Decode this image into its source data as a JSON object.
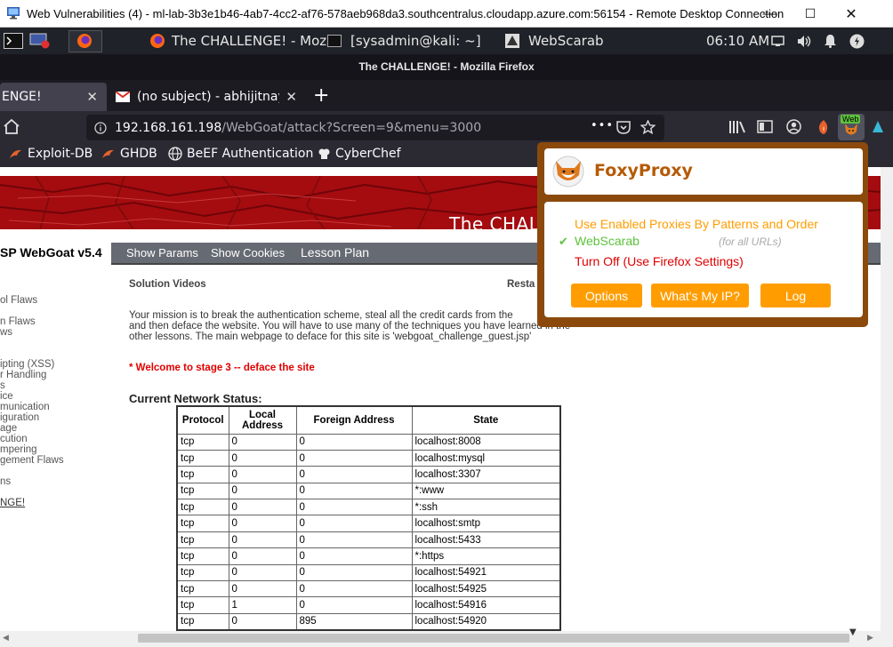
{
  "rdp": {
    "title": "Web Vulnerabilities (4) - ml-lab-3b3e1b46-4ab7-4cc2-af76-578aeb968da3.southcentralus.cloudapp.azure.com:56154 - Remote Desktop Connection",
    "minimize": "—",
    "maximize": "☐",
    "close": "✕"
  },
  "taskbar": {
    "items": [
      "The CHALLENGE! - Moz...",
      "[sysadmin@kali: ~]",
      "WebScarab"
    ],
    "clock": "06:10 AM"
  },
  "firefox": {
    "window_title": "The CHALLENGE! - Mozilla Firefox",
    "tabs": [
      {
        "label": "ENGE!"
      },
      {
        "label": "(no subject) - abhijitnayak"
      }
    ],
    "new_tab": "+",
    "url_host": "192.168.161.198",
    "url_path": "/WebGoat/attack?Screen=9&menu=3000",
    "url_more": "•••",
    "extension_badge": "Web",
    "bookmarks": [
      "Exploit-DB",
      "GHDB",
      "BeEF Authentication",
      "CyberChef"
    ]
  },
  "webgoat": {
    "banner_title": "The CHALL",
    "version_label": "SP WebGoat  v5.4",
    "menu": [
      "Show Params",
      "Show Cookies",
      "Lesson Plan"
    ],
    "left_nav": [
      "ol Flaws",
      "n Flaws",
      "ws",
      "ipting (XSS)",
      "r Handling",
      "s",
      "ice",
      "munication",
      "iguration",
      "age",
      "cution",
      "mpering",
      "gement Flaws",
      "ns"
    ],
    "challenge_link": "NGE!",
    "solution_videos": "Solution Videos",
    "restart": "Resta",
    "mission_lines": [
      "Your mission is to break the authentication scheme, steal all the credit cards from the",
      "and then deface the website. You will have to use many of the techniques you have learned in the",
      "other lessons. The main webpage to deface for this site is 'webgoat_challenge_guest.jsp'"
    ],
    "stage_message": "* Welcome to stage 3 -- deface the site",
    "network_heading": "Current Network Status:",
    "table_headers": [
      "Protocol",
      "Local Address",
      "Foreign Address",
      "State"
    ],
    "table_rows": [
      [
        "tcp",
        "0",
        "0",
        "localhost:8008"
      ],
      [
        "tcp",
        "0",
        "0",
        "localhost:mysql"
      ],
      [
        "tcp",
        "0",
        "0",
        "localhost:3307"
      ],
      [
        "tcp",
        "0",
        "0",
        "*:www"
      ],
      [
        "tcp",
        "0",
        "0",
        "*:ssh"
      ],
      [
        "tcp",
        "0",
        "0",
        "localhost:smtp"
      ],
      [
        "tcp",
        "0",
        "0",
        "localhost:5433"
      ],
      [
        "tcp",
        "0",
        "0",
        "*:https"
      ],
      [
        "tcp",
        "0",
        "0",
        "localhost:54921"
      ],
      [
        "tcp",
        "0",
        "0",
        "localhost:54925"
      ],
      [
        "tcp",
        "1",
        "0",
        "localhost:54916"
      ],
      [
        "tcp",
        "0",
        "895",
        "localhost:54920"
      ]
    ]
  },
  "foxyproxy": {
    "title": "FoxyProxy",
    "option_patterns": "Use Enabled Proxies By Patterns and Order",
    "option_webscarab": "WebScarab",
    "webscarab_note": "(for all URLs)",
    "option_off": "Turn Off (Use Firefox Settings)",
    "checkmark": "✔",
    "buttons": [
      "Options",
      "What's My IP?",
      "Log"
    ]
  },
  "colors": {
    "foxy_orange": "#ff9d00",
    "foxy_green": "#5cc23c",
    "foxy_red": "#e00000",
    "banner_red": "#a40c10",
    "stage_red": "#e00000"
  }
}
